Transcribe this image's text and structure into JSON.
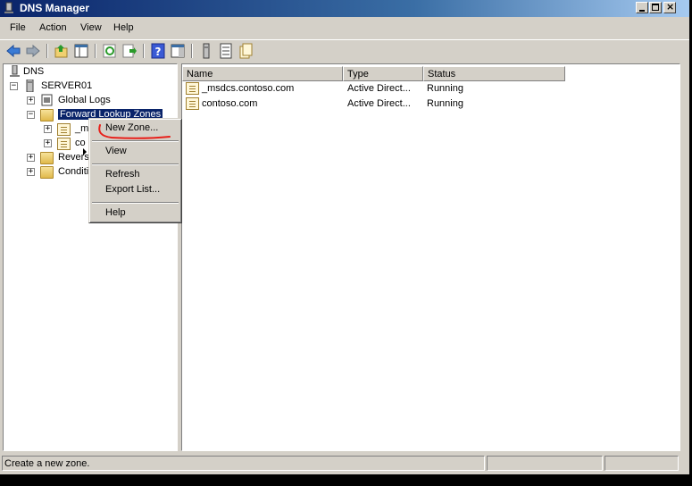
{
  "window": {
    "title": "DNS Manager"
  },
  "menubar": [
    "File",
    "Action",
    "View",
    "Help"
  ],
  "tree": {
    "root": "DNS",
    "server": "SERVER01",
    "global_logs": "Global Logs",
    "forward_lookup_zones": "Forward Lookup Zones",
    "child_msdcs": "_m",
    "child_contoso": "co",
    "reverse": "Revers",
    "conditional": "Conditi"
  },
  "list": {
    "columns": [
      "Name",
      "Type",
      "Status"
    ],
    "rows": [
      {
        "name": "_msdcs.contoso.com",
        "type": "Active Direct...",
        "status": "Running"
      },
      {
        "name": "contoso.com",
        "type": "Active Direct...",
        "status": "Running"
      }
    ]
  },
  "context_menu": {
    "new_zone": "New Zone...",
    "view": "View",
    "refresh": "Refresh",
    "export_list": "Export List...",
    "help": "Help"
  },
  "statusbar": {
    "text": "Create a new zone."
  },
  "colors": {
    "annotation": "#e8201a",
    "selection": "#0a246a",
    "titlebar": "#0a246a"
  }
}
